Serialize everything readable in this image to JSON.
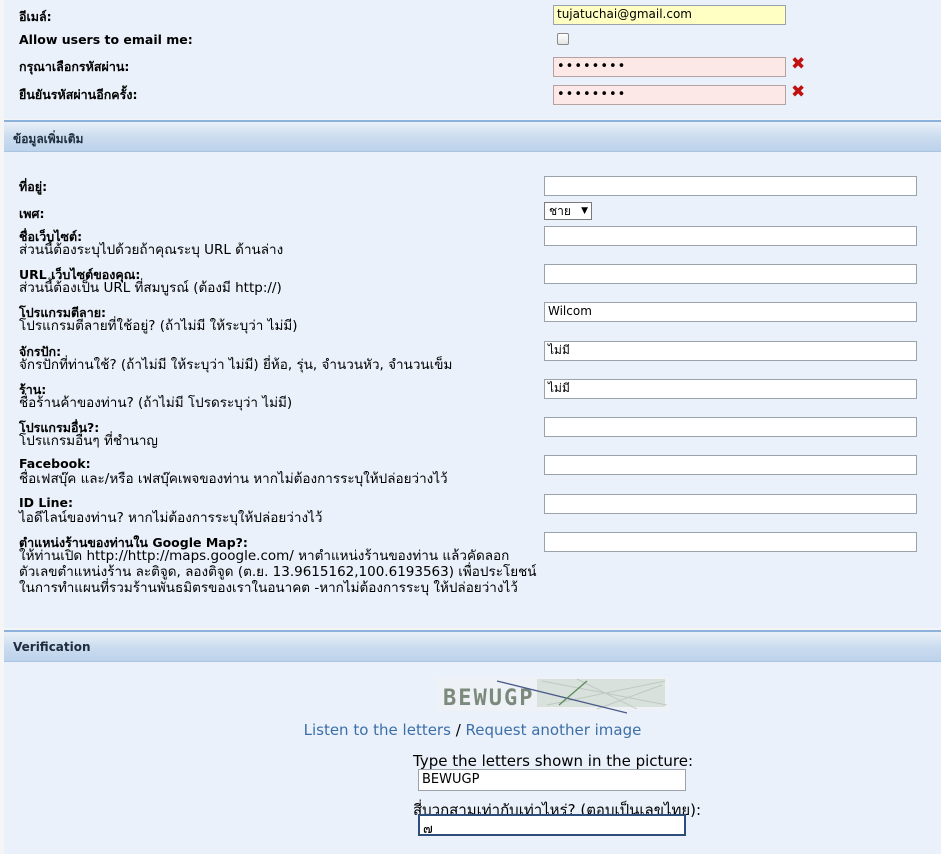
{
  "account": {
    "email_label": "อีเมล์:",
    "email_value": "tujatuchai@gmail.com",
    "allow_email_label": "Allow users to email me:",
    "password_label": "กรุณาเลือกรหัสผ่าน:",
    "password_value": "••••••••",
    "confirm_label": "ยืนยันรหัสผ่านอีกครั้ง:",
    "confirm_value": "••••••••",
    "error_mark": "✖"
  },
  "extra": {
    "header": "ข้อมูลเพิ่มเติม",
    "address_label": "ที่อยู่:",
    "gender_label": "เพศ:",
    "gender_value": "ชาย",
    "site_name_label": "ชื่อเว็บไซต์:",
    "site_name_desc": "ส่วนนี้ต้องระบุไปด้วยถ้าคุณระบุ URL ด้านล่าง",
    "site_url_label": "URL เว็บไซต์ของคุณ:",
    "site_url_desc": "ส่วนนี้ต้องเป็น URL ที่สมบูรณ์ (ต้องมี http://)",
    "embroidery_label": "โปรแกรมตีลาย:",
    "embroidery_desc": "โปรแกรมตีลายที่ใช้อยู่? (ถ้าไม่มี ให้ระบุว่า ไม่มี)",
    "embroidery_value": "Wilcom",
    "machine_label": "จักรปัก:",
    "machine_desc": "จักรปักที่ท่านใช้? (ถ้าไม่มี ให้ระบุว่า ไม่มี) ยี่ห้อ, รุ่น, จำนวนหัว, จำนวนเข็ม",
    "machine_value": "ไม่มี",
    "shop_label": "ร้าน:",
    "shop_desc": "ชื่อร้านค้าของท่าน? (ถ้าไม่มี โปรดระบุว่า ไม่มี)",
    "shop_value": "ไม่มี",
    "other_label": "โปรแกรมอื่น?:",
    "other_desc": "โปรแกรมอื่นๆ ที่ชำนาญ",
    "facebook_label": "Facebook:",
    "facebook_desc": "ชื่อเฟสบุ๊ค และ/หรือ เฟสบุ๊คเพจของท่าน หากไม่ต้องการระบุให้ปล่อยว่างไว้",
    "line_label": "ID Line:",
    "line_desc": "ไอดีไลน์ของท่าน? หากไม่ต้องการระบุให้ปล่อยว่างไว้",
    "map_label": "ตำแหน่งร้านของท่านใน Google Map?:",
    "map_desc": "ให้ท่านเปิด http://http://maps.google.com/ หาตำแหน่งร้านของท่าน แล้วคัดลอก ตัวเลขตำแหน่งร้าน ละติจูด, ลองติจูด (ต.ย. 13.9615162,100.6193563) เพื่อประโยชน์ในการทำแผนที่รวมร้านพันธมิตรของเราในอนาคต -หากไม่ต้องการระบุ ให้ปล่อยว่างไว้"
  },
  "verification": {
    "header": "Verification",
    "captcha_text": "BEWUGP",
    "listen_link": "Listen to the letters",
    "separator": " / ",
    "request_link": "Request another image",
    "type_label": "Type the letters shown in the picture:",
    "type_value": "BEWUGP",
    "question_label": "สี่บวกสามเท่ากับเท่าไหร่? (ตอบเป็นเลขไทย):",
    "question_value": "๗"
  }
}
